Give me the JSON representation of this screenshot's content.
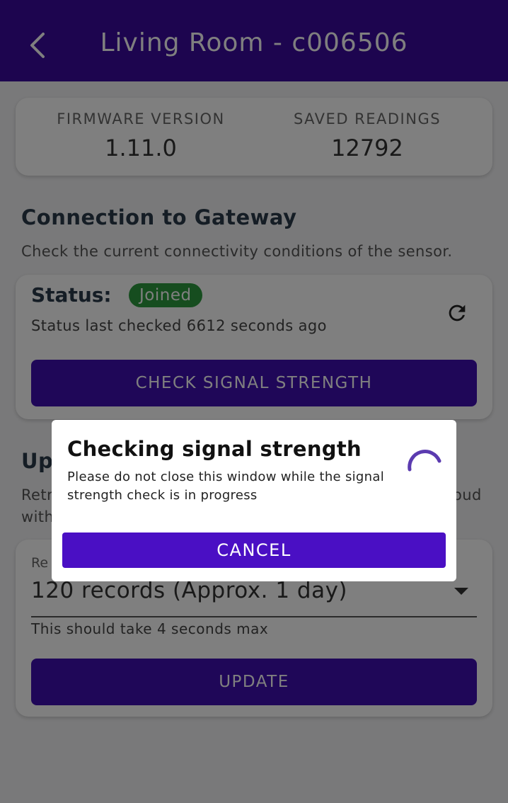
{
  "header": {
    "title": "Living Room - c006506"
  },
  "info": {
    "firmware_label": "FIRMWARE VERSION",
    "firmware_value": "1.11.0",
    "readings_label": "SAVED READINGS",
    "readings_value": "12792"
  },
  "connection": {
    "title": "Connection to Gateway",
    "description": "Check the current connectivity conditions of the sensor.",
    "status_label": "Status:",
    "status_badge": "Joined",
    "status_checked": "Status last checked 6612 seconds ago",
    "check_button": "CHECK SIGNAL STRENGTH"
  },
  "update": {
    "title_partial": "Up",
    "desc_line1_left": "Retr",
    "desc_line1_right": "oud",
    "desc_line2_left": "with",
    "select_label": "Re",
    "select_value": "120 records (Approx. 1 day)",
    "hint": "This should take 4 seconds max",
    "update_button": "UPDATE"
  },
  "dialog": {
    "title": "Checking signal strength",
    "message": "Please do not close this window while the signal strength check is in progress",
    "cancel_button": "CANCEL"
  },
  "colors": {
    "app_bar": "#3a0a9e",
    "primary_button": "#3f0fb0",
    "badge_green": "#2d9a3e",
    "spinner": "#5b3bb0"
  }
}
